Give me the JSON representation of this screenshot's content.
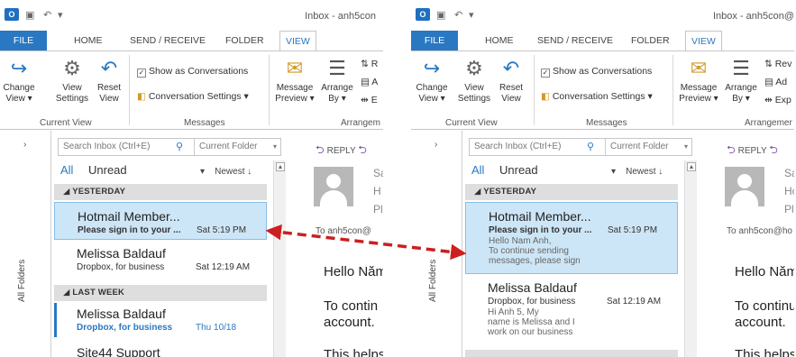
{
  "app": {
    "window_title": "Inbox - anh5con",
    "window_title_right": "Inbox - anh5con@"
  },
  "tabs": [
    "FILE",
    "HOME",
    "SEND / RECEIVE",
    "FOLDER",
    "VIEW"
  ],
  "ribbon": {
    "change_view": [
      "Change",
      "View"
    ],
    "view_settings": [
      "View",
      "Settings"
    ],
    "reset_view": [
      "Reset",
      "View"
    ],
    "current_view_label": "Current View",
    "show_as_conversations": "Show as Conversations",
    "conversation_settings": "Conversation Settings",
    "messages_label": "Messages",
    "message_preview": [
      "Message",
      "Preview"
    ],
    "arrange_by": [
      "Arrange",
      "By"
    ],
    "arrangement_label_left": "Arrangem",
    "arrangement_label_right": "Arrangemer",
    "arr_items_left": [
      "R",
      "A",
      "E"
    ],
    "arr_items_right": [
      "Rev",
      "Ad",
      "Exp"
    ]
  },
  "nav": {
    "all_folders": "All Folders"
  },
  "search": {
    "placeholder": "Search Inbox (Ctrl+E)",
    "scope": "Current Folder"
  },
  "filter": {
    "all": "All",
    "unread": "Unread",
    "sort": "Newest"
  },
  "groups": {
    "yesterday": "YESTERDAY",
    "last_week": "LAST WEEK"
  },
  "left_list": [
    {
      "sender": "Hotmail Member...",
      "subject": "Please sign in to your ...",
      "time": "Sat 5:19 PM"
    },
    {
      "sender": "Melissa Baldauf",
      "subject": "Dropbox, for business",
      "time": "Sat 12:19 AM"
    },
    {
      "sender": "Melissa Baldauf",
      "subject": "Dropbox, for business",
      "time": "Thu 10/18"
    },
    {
      "sender": "Site44 Support"
    }
  ],
  "right_list": [
    {
      "sender": "Hotmail Member...",
      "subject": "Please sign in to your ...",
      "time": "Sat 5:19 PM",
      "preview": "Hello Nam Anh,\nTo continue sending\nmessages, please sign"
    },
    {
      "sender": "Melissa Baldauf",
      "subject": "Dropbox, for business",
      "time": "Sat 12:19 AM",
      "preview": "Hi Anh 5,  My\nname is Melissa and I\nwork on our business"
    }
  ],
  "reading": {
    "reply": "REPLY",
    "reply_right": "REPLY",
    "left_header": [
      "Sa",
      "H",
      "Ple"
    ],
    "right_header": [
      "Sa",
      "Ho",
      "Ple"
    ],
    "to_left": "To  anh5con@",
    "to_right": "To  anh5con@ho",
    "body_left": [
      "Hello Năm",
      "To contin",
      "account.",
      "This helps"
    ],
    "body_right": [
      "Hello Năm",
      "To continu",
      "account.",
      "This helps"
    ]
  },
  "colors": {
    "accent": "#2a78c2",
    "selected_bg": "#cde6f7",
    "arrow": "#cc1f1f"
  }
}
